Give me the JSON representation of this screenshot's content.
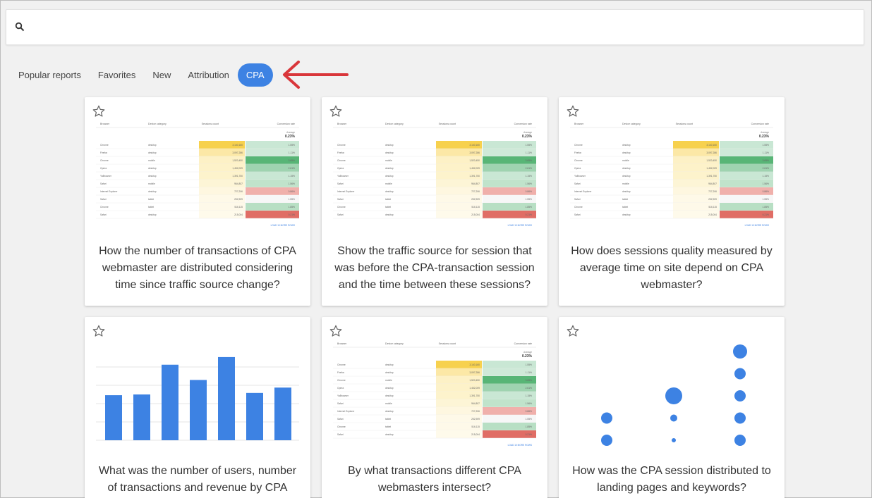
{
  "search": {
    "placeholder": "",
    "value": ""
  },
  "tabs": [
    {
      "label": "Popular reports"
    },
    {
      "label": "Favorites"
    },
    {
      "label": "New"
    },
    {
      "label": "Attribution"
    },
    {
      "label": "CPA",
      "active": true
    }
  ],
  "colors": {
    "accent": "#3d82e3",
    "arrow": "#d9363a",
    "bar": "#3d82e3"
  },
  "cards": [
    {
      "title": "How the number of transactions of CPA webmaster are distributed considering time since traffic source change?",
      "preview": "table"
    },
    {
      "title": "Show the traffic source for session that was before the CPA-transaction session and the time between these sessions?",
      "preview": "table"
    },
    {
      "title": "How does sessions quality measured by average time on site depend on CPA webmaster?",
      "preview": "table"
    },
    {
      "title": "What was the number of users, number of transactions and revenue by CPA",
      "preview": "bar-chart"
    },
    {
      "title": "By what transactions different CPA webmasters intersect?",
      "preview": "table"
    },
    {
      "title": "How was the CPA session distributed to landing pages and keywords?",
      "preview": "dot-chart"
    }
  ],
  "table_preview": {
    "headers": [
      "Browser",
      "Device category",
      "Sessions count",
      "Conversion rate"
    ],
    "average_label": "Average",
    "average_value": "0.23%",
    "load_more": "LOAD 10 MORE ROWS",
    "rows": [
      [
        "Chrome",
        "desktop",
        "3,140,160",
        "1.55%"
      ],
      [
        "Firefox",
        "desktop",
        "3,097,286",
        "1.11%"
      ],
      [
        "Chrome",
        "mobile",
        "1,520,450",
        "3.65%"
      ],
      [
        "Opera",
        "desktop",
        "1,452,009",
        "2.61%"
      ],
      [
        "YaBrowser",
        "desktop",
        "1,391,750",
        "1.15%"
      ],
      [
        "Safari",
        "mobile",
        "964,807",
        "1.56%"
      ],
      [
        "Internet Explorer",
        "desktop",
        "727,206",
        "0.86%"
      ],
      [
        "Safari",
        "tablet",
        "252,909",
        "1.55%"
      ],
      [
        "Chrome",
        "tablet",
        "516,115",
        "1.85%"
      ],
      [
        "Safari",
        "desktop",
        "215,004",
        "0.21%"
      ]
    ]
  },
  "bar_preview": {
    "values": [
      59,
      60,
      99,
      79,
      109,
      62,
      69
    ],
    "ymax": 120
  },
  "dot_preview": {
    "columns": [
      {
        "sizes": [
          8,
          8
        ]
      },
      {
        "sizes": [
          12,
          5,
          3
        ]
      },
      {
        "sizes": [
          10,
          8,
          8,
          8,
          8
        ]
      }
    ]
  }
}
